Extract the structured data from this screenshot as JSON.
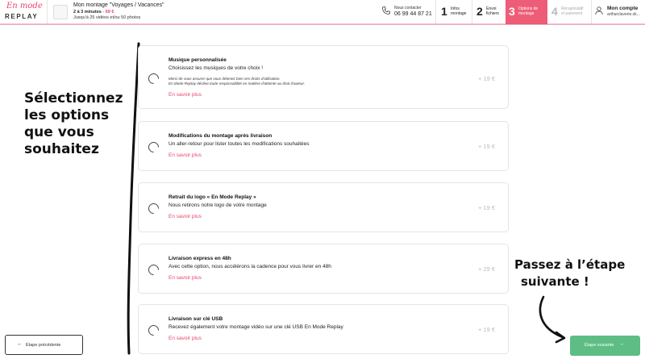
{
  "header": {
    "logo": {
      "script": "En mode",
      "word": "REPLAY"
    },
    "project": {
      "title": "Mon montage \"Voyages / Vacances\"",
      "duration": "2 à 3 minutes",
      "price": "- 69 €",
      "limit": "Jusqu'à 25 vidéos et/ou 50 photos"
    },
    "contact": {
      "label": "Nous contacter",
      "phone": "06 99 44 87 21"
    },
    "steps": [
      {
        "num": "1",
        "label1": "Infos",
        "label2": "montage",
        "state": "done"
      },
      {
        "num": "2",
        "label1": "Envoi",
        "label2": "fichiers",
        "state": "done"
      },
      {
        "num": "3",
        "label1": "Options de",
        "label2": "montage",
        "state": "active"
      },
      {
        "num": "4",
        "label1": "Récapitulatif",
        "label2": "et paiement",
        "state": "disabled"
      }
    ],
    "account": {
      "title": "Mon compte",
      "email": "arthurclaverie.sk..."
    }
  },
  "instructions": {
    "left": [
      "Sélectionnez",
      "les options",
      "que vous",
      "souhaitez"
    ],
    "right": [
      "Passez à l’étape",
      "suivante !"
    ]
  },
  "options": [
    {
      "title": "Musique personnalisée",
      "desc": "Choisissez les musiques de votre choix !",
      "note1": "Merci de vous assurer que vous détenez bien ses droits d'utilisation.",
      "note2": "En Mode Replay décline toute responsabilité en matière d'atteinte au droit d'auteur.",
      "link": "En savoir plus",
      "price": "+ 19 €"
    },
    {
      "title": "Modifications du montage après livraison",
      "desc": "Un aller-retour pour lister toutes les modifications souhaitées",
      "link": "En savoir plus",
      "price": "+ 19 €"
    },
    {
      "title": "Retrait du logo « En Mode Replay »",
      "desc": "Nous retirons notre logo de votre montage",
      "link": "En savoir plus",
      "price": "+ 19 €"
    },
    {
      "title": "Livraison express en 48h",
      "desc": "Avec cette option, nous accélérons la cadence pour vous livrer en 48h",
      "link": "En savoir plus",
      "price": "+ 29 €"
    },
    {
      "title": "Livraison sur clé USB",
      "desc": "Recevez également votre montage vidéo sur une clé USB En Mode Replay",
      "link": "En savoir plus",
      "price": "+ 19 €"
    }
  ],
  "buttons": {
    "prev": "Étape précédente",
    "next": "Étape suivante",
    "prev_arrow": "←",
    "next_arrow": "→"
  },
  "colors": {
    "accent": "#e8466a",
    "active_step": "#ee5d78",
    "next_button": "#5dbd84"
  }
}
